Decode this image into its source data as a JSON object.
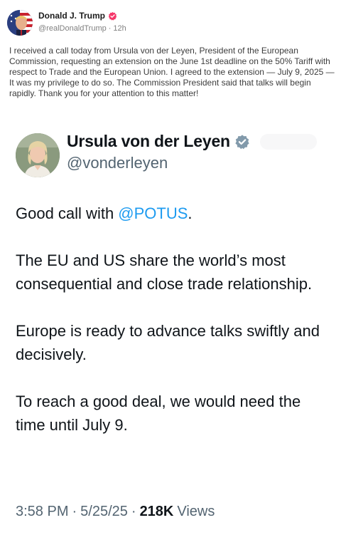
{
  "outer_post": {
    "author_name": "Donald J. Trump",
    "handle": "@realDonaldTrump",
    "separator": "·",
    "time_ago": "12h",
    "verified_color": "#f5386a",
    "body": "I received a call today from Ursula von der Leyen, President of the European Commission, requesting an extension on the June 1st deadline on the 50% Tariff with respect to Trade and the European Union. I agreed to the extension — July 9, 2025 — It was my privilege to do so. The Commission President said that talks will begin rapidly. Thank you for your attention to this matter!"
  },
  "embedded_tweet": {
    "author_name": "Ursula von der Leyen",
    "handle": "@vonderleyen",
    "verified_color": "#829aab",
    "body": {
      "p1_prefix": "Good call with ",
      "p1_mention": "@POTUS",
      "p1_suffix": ".",
      "p2": "The EU and US share the world’s most consequential and close trade relationship.",
      "p3": "Europe is ready to advance talks swiftly and decisively.",
      "p4": "To reach a good deal, we would need the time until July 9."
    },
    "footer": {
      "time": "3:58 PM",
      "sep1": "·",
      "date": "5/25/25",
      "sep2": "·",
      "views_count": "218K",
      "views_label": "Views"
    },
    "mention_color": "#1d9bf0"
  },
  "icons": {
    "outer_avatar": "profile-photo",
    "outer_verified": "verified-badge-icon",
    "embed_avatar": "profile-photo",
    "embed_verified": "verified-badge-icon"
  }
}
